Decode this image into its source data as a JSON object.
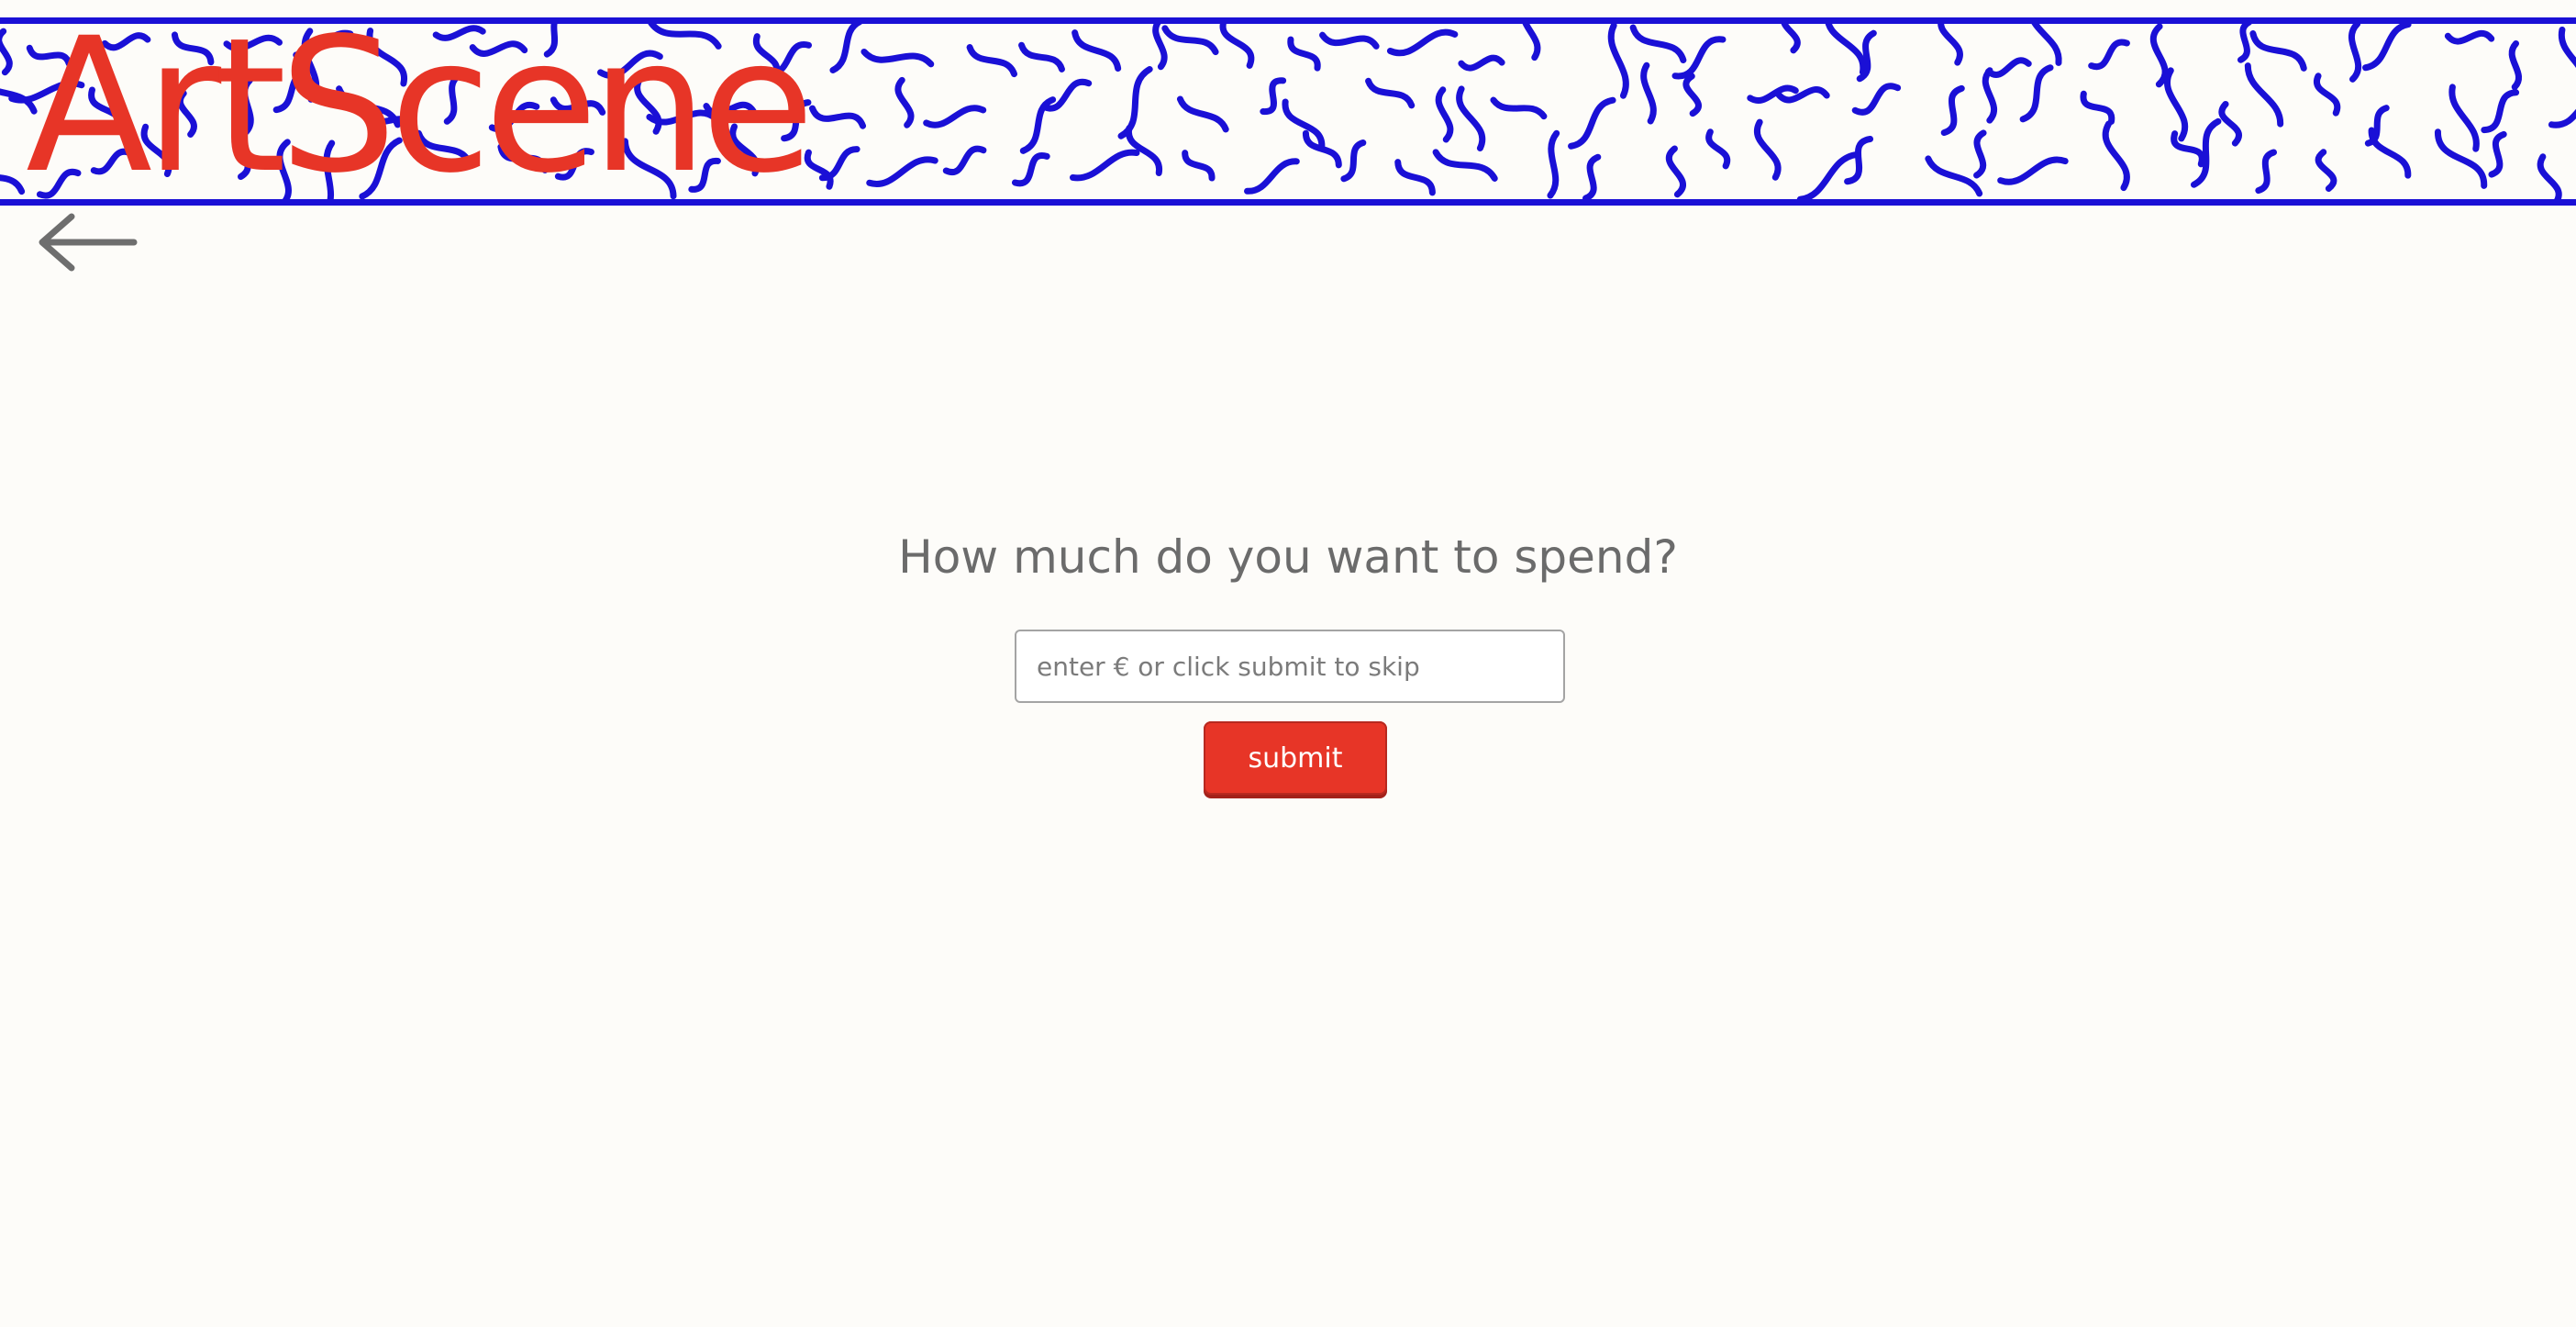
{
  "header": {
    "logo_text": "ArtScene",
    "background_pattern": "blue-squiggle-pattern",
    "colors": {
      "logo": "#e73527",
      "pattern": "#1a10d6",
      "border": "#1a10d6"
    }
  },
  "nav": {
    "back_icon": "arrow-left-icon"
  },
  "form": {
    "question": "How much do you want to spend?",
    "amount_placeholder": "enter € or click submit to skip",
    "amount_value": "",
    "submit_label": "submit"
  },
  "colors": {
    "accent": "#e73527",
    "text": "#6b6b6b",
    "background": "#fdfcf9"
  }
}
